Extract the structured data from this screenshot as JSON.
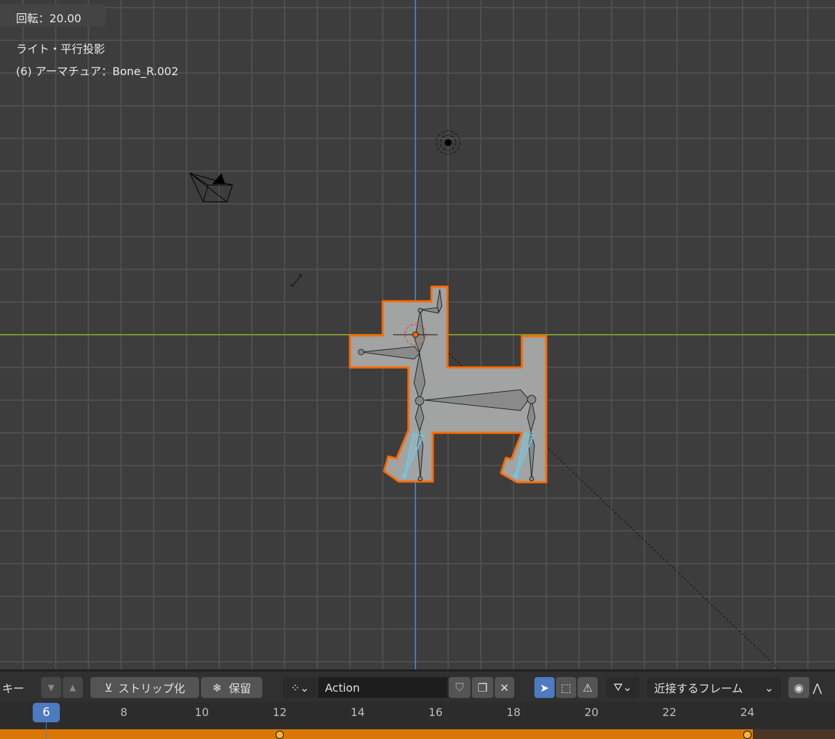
{
  "overlay": {
    "rotation": "回転：20.00",
    "view_name": "ライト・平行投影",
    "object_info": "(6) アーマチュア：Bone_R.002"
  },
  "toolbar": {
    "keys_label": "キー",
    "push_down_label": "ストリップ化",
    "stash_label": "保留",
    "action_name": "Action",
    "snap_mode": "近接するフレーム"
  },
  "timeline": {
    "current_frame": "6",
    "ticks": [
      "8",
      "10",
      "12",
      "14",
      "16",
      "18",
      "20",
      "22",
      "24"
    ],
    "keyframes": [
      12,
      24
    ]
  },
  "colors": {
    "accent": "#4d7ac0",
    "selection": "#ff6a00",
    "x_axis": "#7a9a2e",
    "z_axis": "#4a78b8",
    "track": "#d97706",
    "keyframe": "#f5b731",
    "active_bone": "#5fd0f0"
  }
}
